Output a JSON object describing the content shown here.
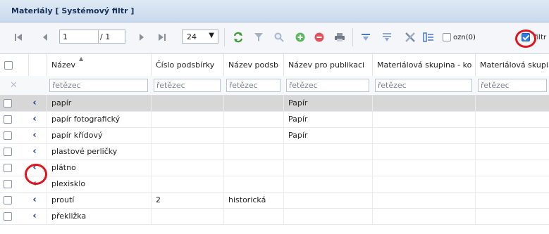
{
  "window": {
    "title": "Materiály  [ Systémový filtr ]"
  },
  "toolbar": {
    "page_input": "1",
    "page_total": "/ 1",
    "page_size": "24",
    "ozn_label": "ozn(0)",
    "filtr_label": "filtr",
    "filtr_checked": true
  },
  "grid": {
    "columns": [
      "Název",
      "Číslo podsbírky",
      "Název podsb",
      "Název pro publikaci",
      "Materiálová skupina - ko",
      "Materiálová skupi"
    ],
    "filter_placeholder": "řetězec",
    "rows": [
      {
        "nazev": "papír",
        "cislo": "",
        "nazev_podsb": "",
        "publikace": "Papír",
        "selected": true
      },
      {
        "nazev": "papír fotografický",
        "cislo": "",
        "nazev_podsb": "",
        "publikace": "Papír",
        "selected": false
      },
      {
        "nazev": "papír křídový",
        "cislo": "",
        "nazev_podsb": "",
        "publikace": "Papír",
        "selected": false
      },
      {
        "nazev": "plastové perličky",
        "cislo": "",
        "nazev_podsb": "",
        "publikace": "",
        "selected": false
      },
      {
        "nazev": "plátno",
        "cislo": "",
        "nazev_podsb": "",
        "publikace": "",
        "selected": false
      },
      {
        "nazev": "plexisklo",
        "cislo": "",
        "nazev_podsb": "",
        "publikace": "",
        "selected": false
      },
      {
        "nazev": "proutí",
        "cislo": "2",
        "nazev_podsb": "historická",
        "publikace": "",
        "selected": false
      },
      {
        "nazev": "překližka",
        "cislo": "",
        "nazev_podsb": "",
        "publikace": "",
        "selected": false
      }
    ]
  }
}
